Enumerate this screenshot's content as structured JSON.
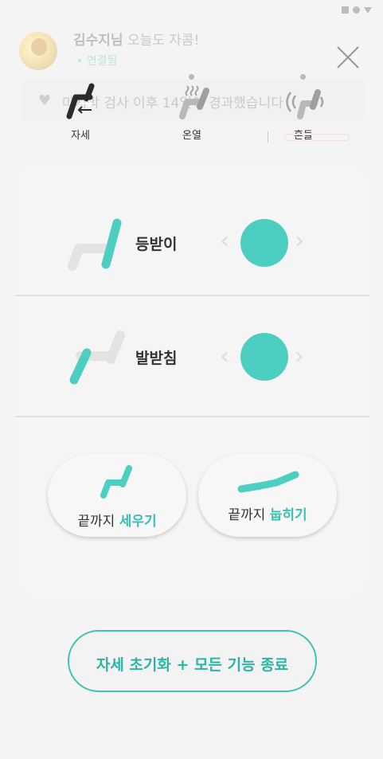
{
  "background": {
    "user_name": "김수지님",
    "greeting_suffix": " 오늘도 자콤!",
    "connection_status": "• 연결됨",
    "notice_text": "마지막 검사 이후 14일이 경과했습니다"
  },
  "modes": [
    {
      "label": "자세",
      "icon": "posture-swap-icon",
      "active": true
    },
    {
      "label": "온열",
      "icon": "heat-seat-icon",
      "active": false
    },
    {
      "label": "흔들",
      "icon": "vibration-seat-icon",
      "active": false
    }
  ],
  "controls": {
    "backrest_label": "등받이",
    "footrest_label": "발받침"
  },
  "presets": {
    "upright_prefix": "끝까지 ",
    "upright_highlight": "세우기",
    "recline_prefix": "끝까지 ",
    "recline_highlight": "눕히기"
  },
  "reset_button": "자세 초기화 + 모든 기능 종료",
  "colors": {
    "accent": "#4ccec0",
    "accent_text": "#38c1b3",
    "inactive": "#bdbdbd"
  }
}
